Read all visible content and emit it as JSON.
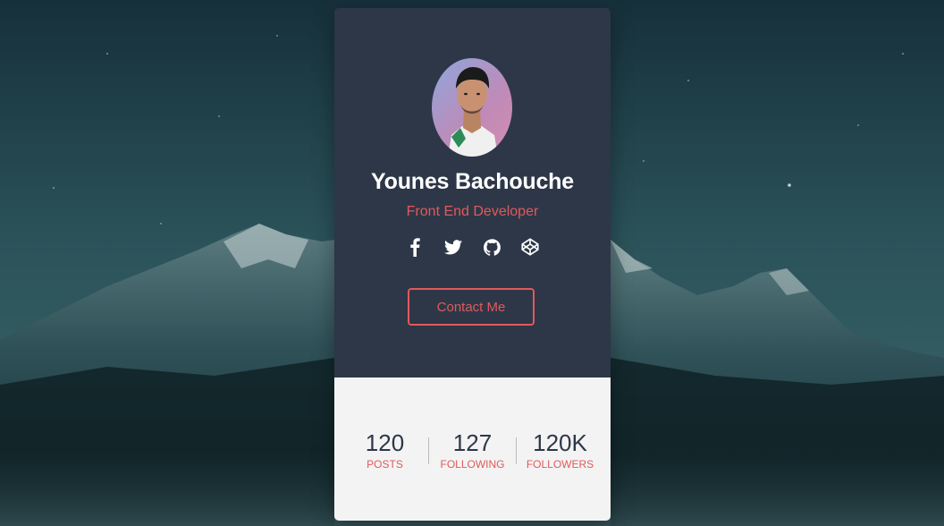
{
  "profile": {
    "name": "Younes Bachouche",
    "role": "Front End Developer",
    "avatar_icon": "user-photo"
  },
  "socials": [
    {
      "icon": "facebook-icon"
    },
    {
      "icon": "twitter-icon"
    },
    {
      "icon": "github-icon"
    },
    {
      "icon": "codepen-icon"
    }
  ],
  "contact_button": {
    "label": "Contact Me"
  },
  "stats": [
    {
      "value": "120",
      "label": "POSTS"
    },
    {
      "value": "127",
      "label": "FOLLOWING"
    },
    {
      "value": "120K",
      "label": "FOLLOWERS"
    }
  ],
  "colors": {
    "card_dark": "#2d3748",
    "accent": "#e05a5a",
    "card_light": "#f3f3f4"
  }
}
